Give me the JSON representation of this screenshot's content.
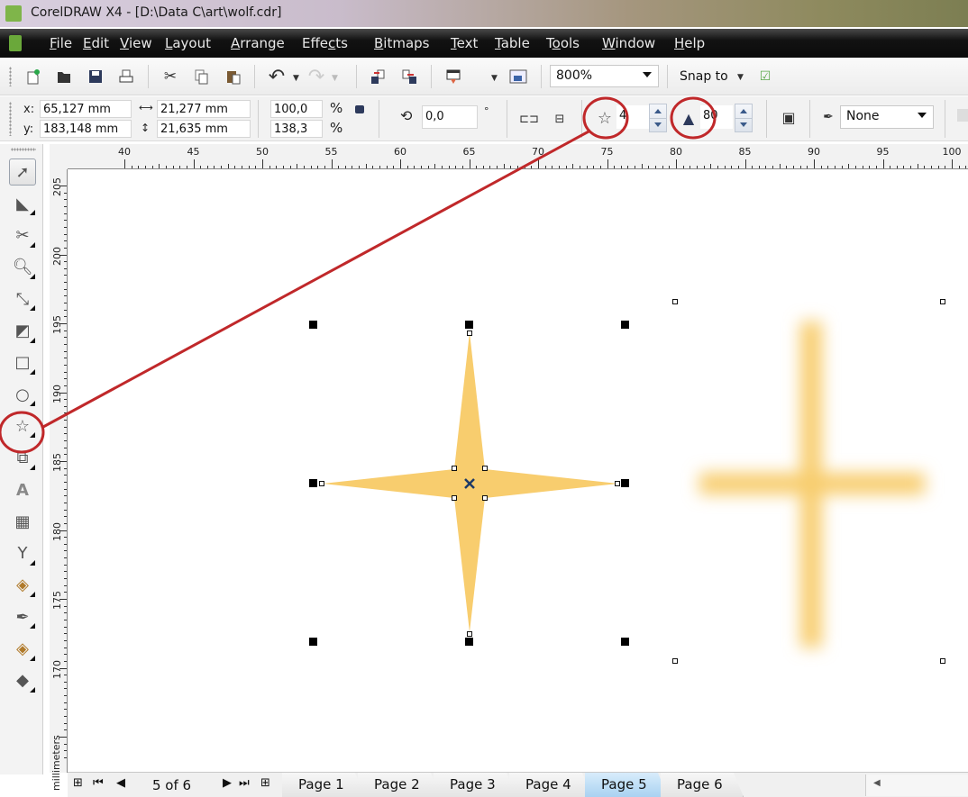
{
  "window": {
    "title": "CorelDRAW X4 - [D:\\Data C\\art\\wolf.cdr]"
  },
  "menubar": {
    "items": [
      {
        "label": "File",
        "mnemonic_index": 0
      },
      {
        "label": "Edit",
        "mnemonic_index": 0
      },
      {
        "label": "View",
        "mnemonic_index": 0
      },
      {
        "label": "Layout",
        "mnemonic_index": 0
      },
      {
        "label": "Arrange",
        "mnemonic_index": 0
      },
      {
        "label": "Effects",
        "mnemonic_index": 4
      },
      {
        "label": "Bitmaps",
        "mnemonic_index": 0
      },
      {
        "label": "Text",
        "mnemonic_index": 0
      },
      {
        "label": "Table",
        "mnemonic_index": 0
      },
      {
        "label": "Tools",
        "mnemonic_index": 1
      },
      {
        "label": "Window",
        "mnemonic_index": 0
      },
      {
        "label": "Help",
        "mnemonic_index": 0
      }
    ]
  },
  "standard_toolbar": {
    "buttons": [
      {
        "name": "new-document",
        "icon": "new-document-icon"
      },
      {
        "name": "open",
        "icon": "folder-open-icon"
      },
      {
        "name": "save",
        "icon": "floppy-disk-icon"
      },
      {
        "name": "print",
        "icon": "printer-icon"
      },
      {
        "name": "cut",
        "icon": "scissors-icon"
      },
      {
        "name": "copy",
        "icon": "copy-icon"
      },
      {
        "name": "paste",
        "icon": "clipboard-icon"
      },
      {
        "name": "undo",
        "icon": "undo-arrow-icon"
      },
      {
        "name": "redo",
        "icon": "redo-arrow-icon"
      },
      {
        "name": "import",
        "icon": "import-icon"
      },
      {
        "name": "export",
        "icon": "export-icon"
      },
      {
        "name": "application-launcher",
        "icon": "launcher-icon"
      },
      {
        "name": "welcome-screen",
        "icon": "welcome-screen-icon"
      }
    ],
    "zoom_level": "800%",
    "snap_to_label": "Snap to"
  },
  "property_bar": {
    "x_label": "x:",
    "x_value": "65,127 mm",
    "y_label": "y:",
    "y_value": "183,148 mm",
    "width_value": "21,277 mm",
    "height_value": "21,635 mm",
    "scale_x": "100,0",
    "scale_y": "138,3",
    "percent_symbol": "%",
    "rotation_value": "0,0",
    "degree_symbol": "°",
    "star_points_value": "4",
    "star_sharpness_value": "80",
    "outline_width": "None"
  },
  "toolbox": {
    "tools": [
      {
        "name": "pick-tool",
        "icon": "pointer-arrow-icon",
        "active": false,
        "flyout": false
      },
      {
        "name": "shape-tool",
        "icon": "shape-node-icon",
        "active": false,
        "flyout": true
      },
      {
        "name": "crop-tool",
        "icon": "crop-icon",
        "active": false,
        "flyout": true
      },
      {
        "name": "zoom-tool",
        "icon": "magnifier-icon",
        "active": false,
        "flyout": true
      },
      {
        "name": "freehand-tool",
        "icon": "freehand-curve-icon",
        "active": false,
        "flyout": true
      },
      {
        "name": "smart-fill-tool",
        "icon": "smart-fill-icon",
        "active": false,
        "flyout": true
      },
      {
        "name": "rectangle-tool",
        "icon": "rectangle-icon",
        "active": false,
        "flyout": true
      },
      {
        "name": "ellipse-tool",
        "icon": "ellipse-icon",
        "active": false,
        "flyout": true
      },
      {
        "name": "star-tool",
        "icon": "star-icon",
        "active": true,
        "flyout": true
      },
      {
        "name": "basic-shapes-tool",
        "icon": "basic-shapes-icon",
        "active": false,
        "flyout": true
      },
      {
        "name": "text-tool",
        "icon": "text-a-icon",
        "active": false,
        "flyout": false
      },
      {
        "name": "table-tool",
        "icon": "table-grid-icon",
        "active": false,
        "flyout": false
      },
      {
        "name": "interactive-blend-tool",
        "icon": "goblet-icon",
        "active": false,
        "flyout": true
      },
      {
        "name": "eyedropper-tool",
        "icon": "paint-bucket-icon",
        "active": false,
        "flyout": true
      },
      {
        "name": "outline-tool",
        "icon": "pen-nib-icon",
        "active": false,
        "flyout": true
      },
      {
        "name": "fill-tool",
        "icon": "fill-bucket-icon",
        "active": false,
        "flyout": true
      },
      {
        "name": "interactive-fill-tool",
        "icon": "interactive-fill-icon",
        "active": false,
        "flyout": true
      }
    ]
  },
  "rulers": {
    "horizontal_ticks": [
      "40",
      "45",
      "50",
      "55",
      "60",
      "65",
      "70",
      "75",
      "80",
      "85",
      "90",
      "95",
      "100"
    ],
    "vertical_ticks": [
      "205",
      "200",
      "195",
      "190",
      "185",
      "180",
      "175",
      "170"
    ],
    "units": "millimeters"
  },
  "canvas": {
    "selected_shape": "four-point star",
    "fill_color": "#f8cd6e",
    "blurred_copy_color": "#f8cd6e",
    "annotation_color": "#c0282a"
  },
  "page_navigator": {
    "counter": "5 of 6",
    "tabs": [
      "Page 1",
      "Page 2",
      "Page 3",
      "Page 4",
      "Page 5",
      "Page 6"
    ],
    "active_tab_index": 4
  }
}
